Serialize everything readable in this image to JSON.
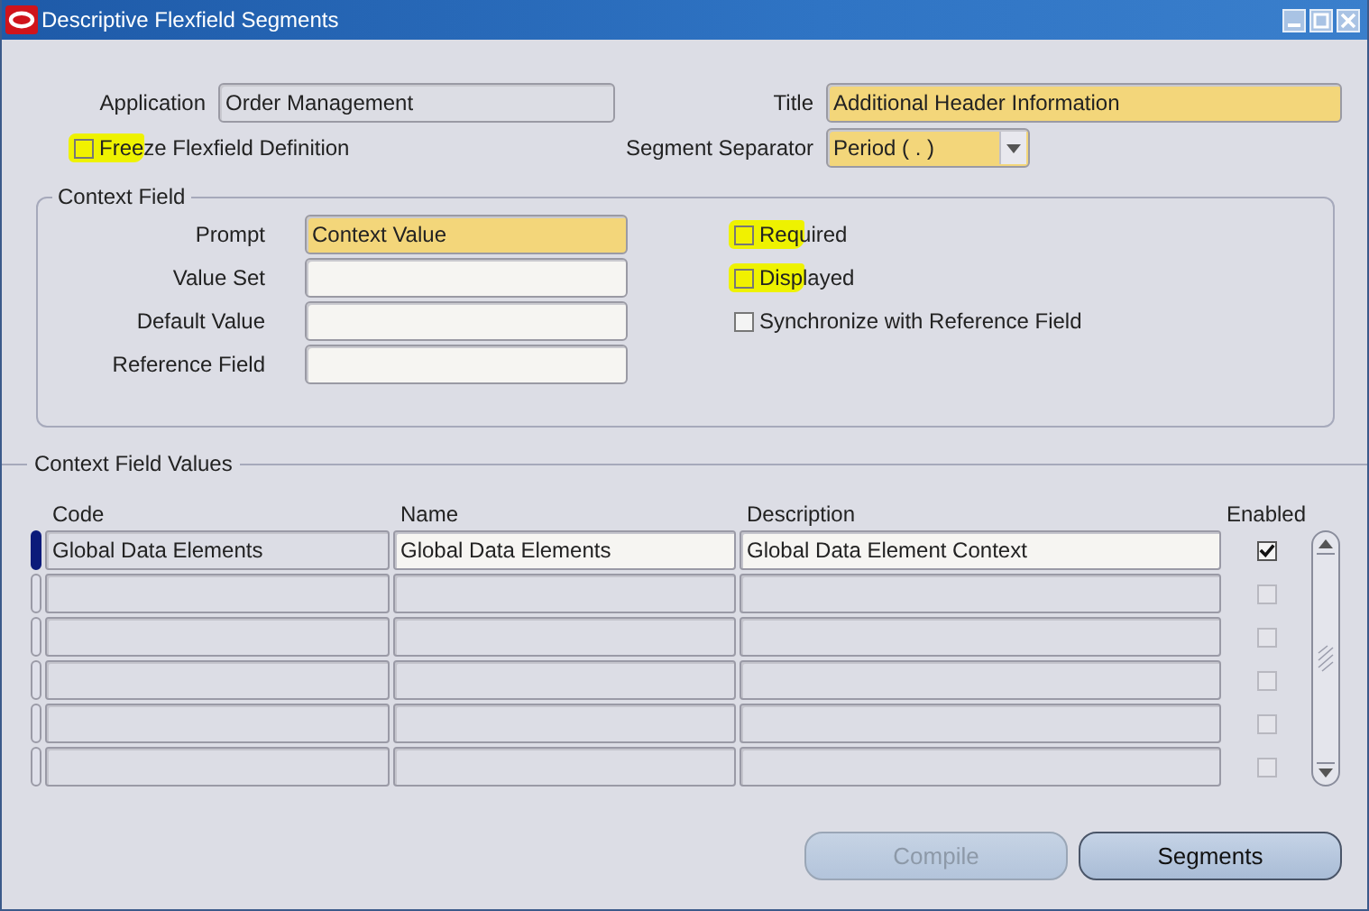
{
  "window": {
    "title": "Descriptive Flexfield Segments"
  },
  "header": {
    "application": {
      "label": "Application",
      "value": "Order Management",
      "required": false
    },
    "title": {
      "label": "Title",
      "value": "Additional Header Information",
      "required": true
    },
    "freeze": {
      "label": "Freeze Flexfield Definition",
      "checked": false,
      "highlighted": true
    },
    "segment_separator": {
      "label": "Segment Separator",
      "value": "Period ( . )",
      "required": true
    }
  },
  "context_field": {
    "title": "Context Field",
    "fields": [
      {
        "label": "Prompt",
        "value": "Context Value",
        "required": true
      },
      {
        "label": "Value Set",
        "required": false
      },
      {
        "label": "Default Value",
        "required": false
      },
      {
        "label": "Reference Field",
        "required": false
      }
    ],
    "options": [
      {
        "label": "Required",
        "checked": false,
        "highlighted": true
      },
      {
        "label": "Displayed",
        "checked": false,
        "highlighted": true
      },
      {
        "label": "Synchronize with Reference Field",
        "checked": false,
        "highlighted": false
      }
    ]
  },
  "context_field_values": {
    "title": "Context Field Values",
    "columns": [
      "Code",
      "Name",
      "Description",
      "Enabled"
    ],
    "rows": [
      {
        "code": "Global Data Elements",
        "name": "Global Data Elements",
        "description": "Global Data Element Context",
        "enabled": true,
        "selected": true
      },
      {
        "enabled": false,
        "selected": false
      },
      {
        "enabled": false,
        "selected": false
      },
      {
        "enabled": false,
        "selected": false
      },
      {
        "enabled": false,
        "selected": false
      },
      {
        "enabled": false,
        "selected": false
      }
    ]
  },
  "buttons": [
    {
      "label": "Compile",
      "disabled": true
    },
    {
      "label": "Segments",
      "disabled": false
    }
  ]
}
